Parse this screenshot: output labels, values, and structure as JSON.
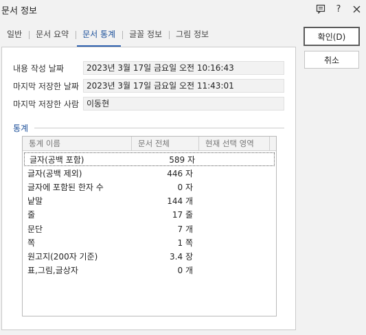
{
  "window": {
    "title": "문서 정보",
    "icons": [
      "message-icon",
      "help-icon",
      "close-icon"
    ]
  },
  "tabs": [
    {
      "label": "일반"
    },
    {
      "label": "문서 요약"
    },
    {
      "label": "문서 통계",
      "active": true
    },
    {
      "label": "글꼴 정보"
    },
    {
      "label": "그림 정보"
    }
  ],
  "fields": {
    "created_label": "내용 작성 날짜",
    "created_value": "2023년 3월 17일 금요일 오전 10:16:43",
    "saved_label": "마지막 저장한 날짜",
    "saved_value": "2023년 3월 17일 금요일 오전 11:43:01",
    "saver_label": "마지막 저장한 사람",
    "saver_value": "이동현"
  },
  "stats": {
    "section_title": "통계",
    "columns": [
      "통계 이름",
      "문서 전체",
      "현재 선택 영역"
    ],
    "rows": [
      {
        "name": "글자(공백 포함)",
        "total": "589 자",
        "selection": ""
      },
      {
        "name": "글자(공백 제외)",
        "total": "446 자",
        "selection": ""
      },
      {
        "name": "글자에 포함된 한자 수",
        "total": "0 자",
        "selection": ""
      },
      {
        "name": "낱말",
        "total": "144 개",
        "selection": ""
      },
      {
        "name": "줄",
        "total": "17 줄",
        "selection": ""
      },
      {
        "name": "문단",
        "total": "7 개",
        "selection": ""
      },
      {
        "name": "쪽",
        "total": "1 쪽",
        "selection": ""
      },
      {
        "name": "원고지(200자 기준)",
        "total": "3.4 장",
        "selection": ""
      },
      {
        "name": "표,그림,글상자",
        "total": "0 개",
        "selection": ""
      }
    ]
  },
  "buttons": {
    "ok_label": "확인(D)",
    "cancel_label": "취소"
  }
}
